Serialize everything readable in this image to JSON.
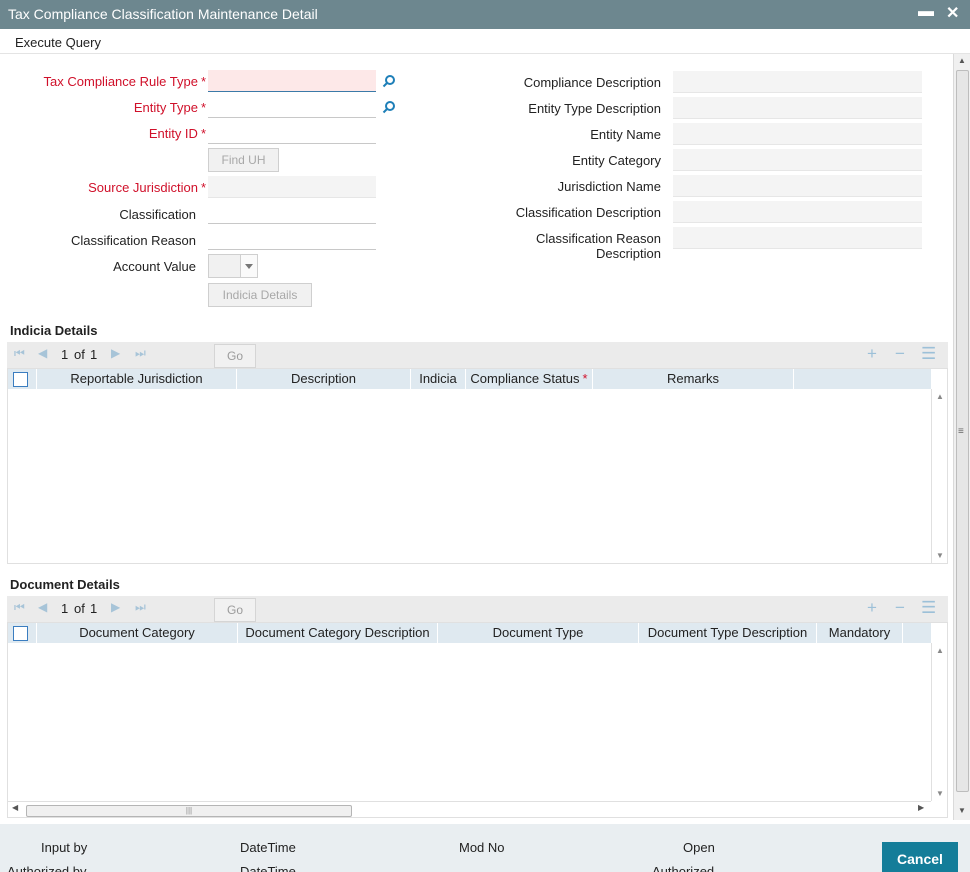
{
  "window": {
    "title": "Tax Compliance Classification Maintenance Detail",
    "minimize_glyph": "▬",
    "close_glyph": "✕"
  },
  "menu": {
    "execute_query": "Execute Query"
  },
  "form": {
    "tax_rule_type": {
      "label": "Tax Compliance Rule Type",
      "value": ""
    },
    "entity_type": {
      "label": "Entity Type",
      "value": ""
    },
    "entity_id": {
      "label": "Entity ID",
      "value": ""
    },
    "find_uh": "Find UH",
    "source_jurisdiction": {
      "label": "Source Jurisdiction",
      "value": ""
    },
    "classification": {
      "label": "Classification",
      "value": ""
    },
    "classification_reason": {
      "label": "Classification Reason",
      "value": ""
    },
    "account_value": {
      "label": "Account Value"
    },
    "indicia_details_btn": "Indicia Details",
    "required_mark": "*"
  },
  "right": {
    "compliance_description": "Compliance Description",
    "entity_type_description": "Entity Type Description",
    "entity_name": "Entity Name",
    "entity_category": "Entity Category",
    "jurisdiction_name": "Jurisdiction Name",
    "classification_description": "Classification Description",
    "classification_reason_description_1": "Classification Reason",
    "classification_reason_description_2": "Description"
  },
  "indicia": {
    "title": "Indicia Details",
    "page": "1",
    "of_label": "of",
    "total": "1",
    "go": "Go",
    "columns": [
      "Reportable Jurisdiction",
      "Description",
      "Indicia",
      "Compliance Status",
      "Remarks"
    ],
    "required_col_mark": "*"
  },
  "documents": {
    "title": "Document Details",
    "page": "1",
    "of_label": "of",
    "total": "1",
    "go": "Go",
    "columns": [
      "Document Category",
      "Document Category Description",
      "Document Type",
      "Document Type Description",
      "Mandatory"
    ]
  },
  "footer": {
    "input_by": "Input by",
    "datetime_1": "DateTime",
    "mod_no": "Mod No",
    "open": "Open",
    "authorized_by": "Authorized by",
    "datetime_2": "DateTime",
    "authorized": "Authorized",
    "cancel": "Cancel"
  },
  "icons": {
    "lov": "magnifier-icon",
    "first": "⏮",
    "prev": "◀",
    "next": "▶",
    "last": "⏭",
    "add": "+",
    "remove": "−",
    "list": "☰"
  },
  "colors": {
    "titlebar": "#6d878f",
    "required": "#d0102a",
    "accent": "#147d99",
    "grid_header": "#dfe9f0"
  }
}
